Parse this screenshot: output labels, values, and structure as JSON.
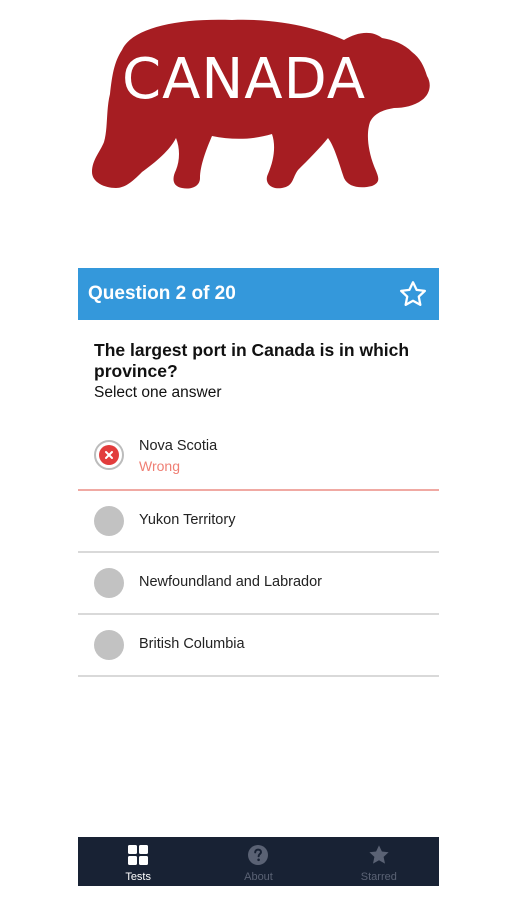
{
  "logo": {
    "text": "CANADA",
    "icon": "bear-silhouette-icon",
    "color": "#a61d22"
  },
  "question": {
    "counter": "Question 2 of 20",
    "header_color": "#3498db",
    "star_icon": "star-outline-icon",
    "text": "The largest port in Canada is in which province?",
    "hint": "Select one answer"
  },
  "answers": [
    {
      "label": "Nova Scotia",
      "status": "Wrong",
      "state": "wrong"
    },
    {
      "label": "Yukon Territory",
      "state": "unselected"
    },
    {
      "label": "Newfoundland and Labrador",
      "state": "unselected"
    },
    {
      "label": "British Columbia",
      "state": "unselected"
    }
  ],
  "colors": {
    "wrong": "#e23c3c",
    "wrong_text": "#ef7f74",
    "nav_background": "#182234"
  },
  "nav": {
    "items": [
      {
        "label": "Tests",
        "icon": "grid-icon",
        "active": true
      },
      {
        "label": "About",
        "icon": "help-circle-icon",
        "active": false
      },
      {
        "label": "Starred",
        "icon": "star-icon",
        "active": false
      }
    ]
  }
}
